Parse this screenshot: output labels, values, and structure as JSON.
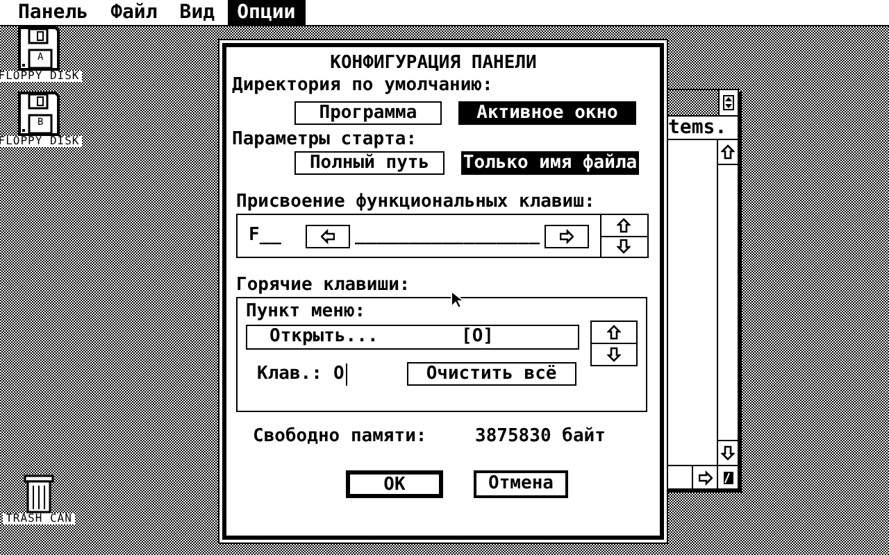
{
  "menu": [
    {
      "label": "Панель",
      "selected": false
    },
    {
      "label": "Файл",
      "selected": false
    },
    {
      "label": "Вид",
      "selected": false
    },
    {
      "label": "Опции",
      "selected": true
    }
  ],
  "desktop_icons": [
    {
      "kind": "floppy",
      "letter": "A",
      "label": "FLOPPY DISK"
    },
    {
      "kind": "floppy",
      "letter": "B",
      "label": "FLOPPY DISK"
    },
    {
      "kind": "trash",
      "label": "TRASH CAN"
    }
  ],
  "background_window": {
    "text": "tems."
  },
  "dialog": {
    "title": "КОНФИГУРАЦИЯ ПАНЕЛИ",
    "default_directory": {
      "label": "Директория по умолчанию:",
      "options": [
        {
          "label": "Программа",
          "selected": false
        },
        {
          "label": "Активное окно",
          "selected": true
        }
      ]
    },
    "start_parameters": {
      "label": "Параметры старта:",
      "options": [
        {
          "label": "Полный путь",
          "selected": false
        },
        {
          "label": "Только имя файла",
          "selected": true
        }
      ]
    },
    "function_keys": {
      "label": "Присвоение функциональных клавиш:",
      "key": "F__",
      "value": "_________________"
    },
    "hotkeys": {
      "label": "Горячие клавиши:",
      "menu_item_label": "Пункт меню:",
      "menu_item": "Открыть...",
      "shortcut": "[O]",
      "key_label": "Клав.:",
      "key_value": "O",
      "clear_button": "Очистить всё"
    },
    "memory": {
      "label": "Свободно памяти:",
      "value": "3875830 байт"
    },
    "buttons": [
      {
        "label": "OK",
        "default": true
      },
      {
        "label": "Отмена",
        "default": false
      }
    ]
  }
}
